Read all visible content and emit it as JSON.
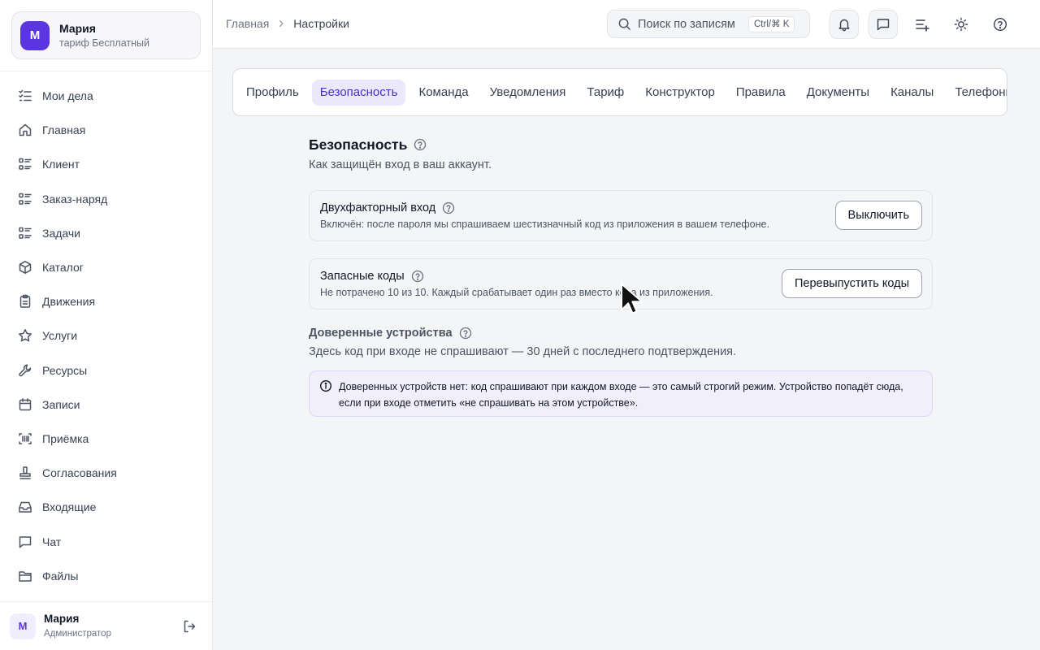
{
  "account": {
    "initial": "М",
    "name": "Мария",
    "plan": "тариф Бесплатный"
  },
  "sidebar": {
    "items": [
      {
        "label": "Мои дела",
        "icon": "list-checks-icon"
      },
      {
        "label": "Главная",
        "icon": "home-icon"
      },
      {
        "label": "Клиент",
        "icon": "list-grid-icon"
      },
      {
        "label": "Заказ-наряд",
        "icon": "list-grid-icon"
      },
      {
        "label": "Задачи",
        "icon": "list-grid-icon"
      },
      {
        "label": "Каталог",
        "icon": "box-icon"
      },
      {
        "label": "Движения",
        "icon": "clipboard-icon"
      },
      {
        "label": "Услуги",
        "icon": "star-icon"
      },
      {
        "label": "Ресурсы",
        "icon": "wrench-icon"
      },
      {
        "label": "Записи",
        "icon": "calendar-icon"
      },
      {
        "label": "Приёмка",
        "icon": "scan-barcode-icon"
      },
      {
        "label": "Согласования",
        "icon": "stamp-icon"
      },
      {
        "label": "Входящие",
        "icon": "inbox-icon"
      },
      {
        "label": "Чат",
        "icon": "chat-icon"
      },
      {
        "label": "Файлы",
        "icon": "folder-icon"
      }
    ]
  },
  "user": {
    "initial": "М",
    "name": "Мария",
    "role": "Администратор"
  },
  "breadcrumb": {
    "home": "Главная",
    "current": "Настройки"
  },
  "search": {
    "placeholder": "Поиск по записям",
    "shortcut": "Ctrl/⌘ K"
  },
  "tabs": [
    {
      "label": "Профиль"
    },
    {
      "label": "Безопасность",
      "active": true
    },
    {
      "label": "Команда"
    },
    {
      "label": "Уведомления"
    },
    {
      "label": "Тариф"
    },
    {
      "label": "Конструктор"
    },
    {
      "label": "Правила"
    },
    {
      "label": "Документы"
    },
    {
      "label": "Каналы"
    },
    {
      "label": "Телефония"
    }
  ],
  "security": {
    "title": "Безопасность",
    "subtitle": "Как защищён вход в ваш аккаунт.",
    "two_factor": {
      "title": "Двухфакторный вход",
      "description": "Включён: после пароля мы спрашиваем шестизначный код из приложения в вашем телефоне.",
      "button": "Выключить"
    },
    "backup_codes": {
      "title": "Запасные коды",
      "description": "Не потрачено 10 из 10. Каждый срабатывает один раз вместо кода из приложения.",
      "button": "Перевыпустить коды"
    },
    "trusted_devices": {
      "title": "Доверенные устройства",
      "description": "Здесь код при входе не спрашивают — 30 дней с последнего подтверждения.",
      "info": "Доверенных устройств нет: код спрашивают при каждом входе — это самый строгий режим. Устройство попадёт сюда, если при входе отметить «не спрашивать на этом устройстве»."
    }
  },
  "colors": {
    "accent": "#5b35e0",
    "accent_bg": "#ebe8fb",
    "page_bg": "#f4f5f7"
  }
}
